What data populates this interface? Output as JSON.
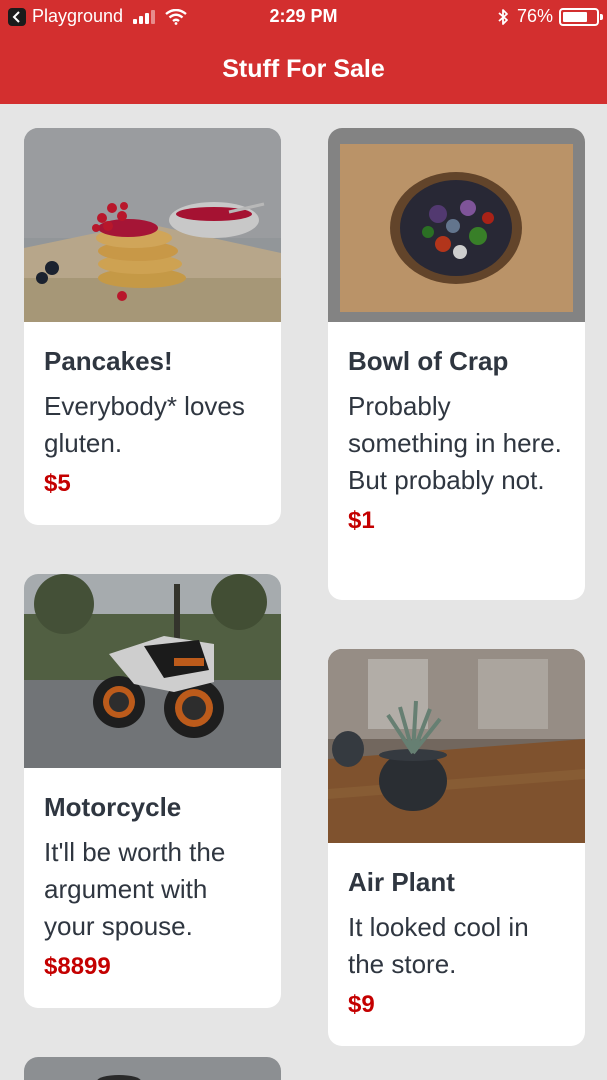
{
  "status_bar": {
    "carrier": "Playground",
    "time": "2:29 PM",
    "battery": "76%",
    "battery_level": 0.76,
    "signal_bars": 3
  },
  "header": {
    "title": "Stuff For Sale"
  },
  "theme": {
    "accent": "#d32f2f",
    "price_color": "#c40000",
    "text_color": "#2f3640",
    "background": "#e5e5e5"
  },
  "products": [
    {
      "title": "Pancakes!",
      "description": "Everybody* loves gluten.",
      "price": "$5",
      "image": "pancakes-photo"
    },
    {
      "title": "Bowl of Crap",
      "description": "Probably something in here. But probably not.",
      "price": "$1",
      "image": "bowl-photo"
    },
    {
      "title": "Motorcycle",
      "description": "It'll be worth the argument with your spouse.",
      "price": "$8899",
      "image": "motorcycle-photo"
    },
    {
      "title": "Air Plant",
      "description": "It looked cool in the store.",
      "price": "$9",
      "image": "air-plant-photo"
    }
  ]
}
